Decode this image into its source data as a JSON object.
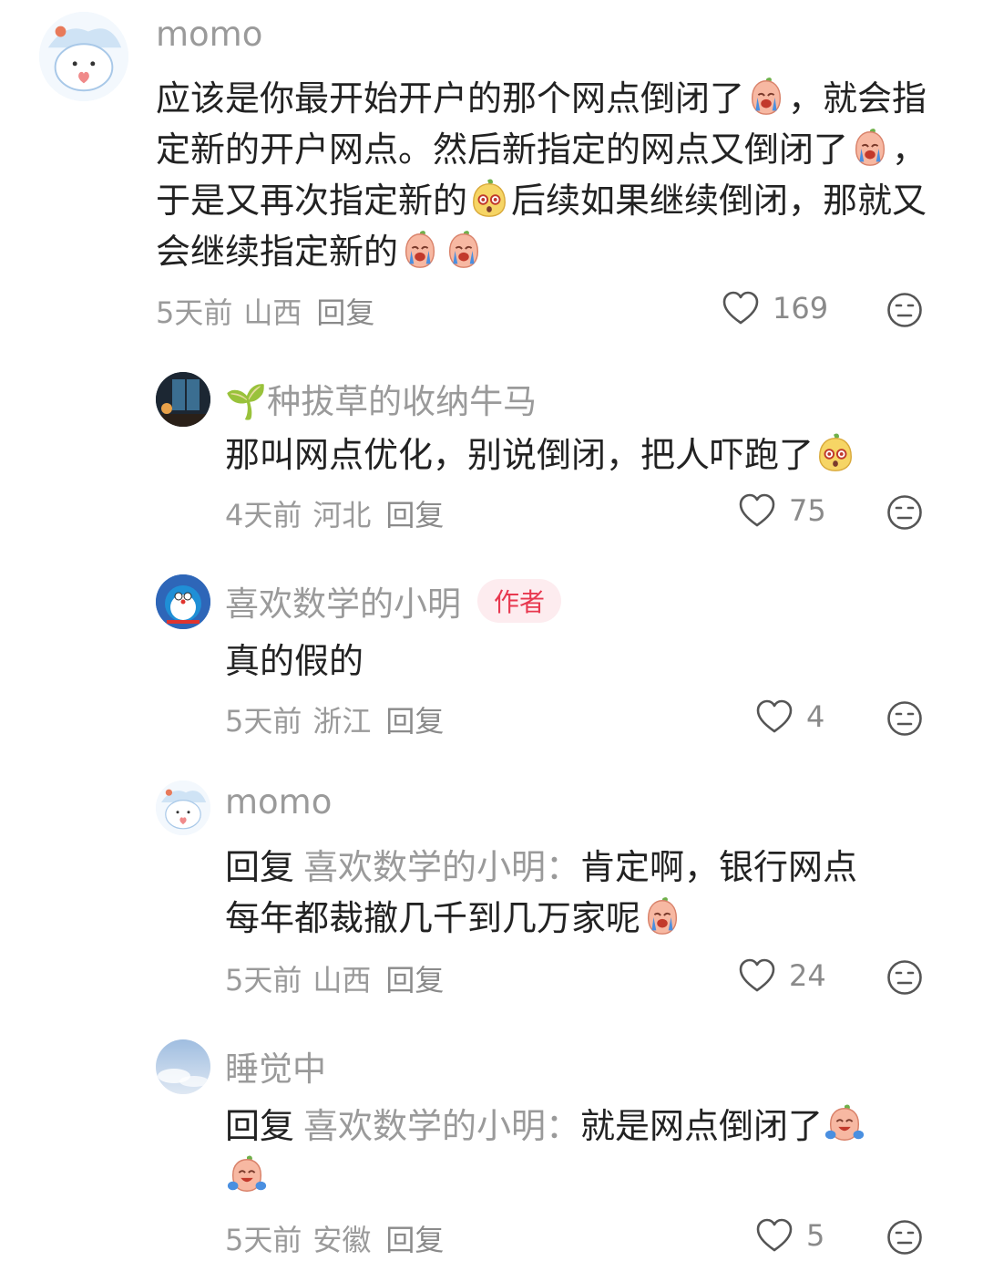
{
  "comments": [
    {
      "user": "momo",
      "text_parts": [
        "应该是你最开始开户的那个网点倒闭了",
        "，就会指定新的开户网点。然后新指定的网点又倒闭了",
        "，于是又再次指定新的",
        "后续如果继续倒闭，那就又会继续指定新的"
      ],
      "time": "5天前",
      "location": "山西",
      "reply_label": "回复",
      "likes": "169"
    },
    {
      "user": "🌱种拔草的收纳牛马",
      "text": "那叫网点优化，别说倒闭，把人吓跑了",
      "time": "4天前",
      "location": "河北",
      "reply_label": "回复",
      "likes": "75"
    },
    {
      "user": "喜欢数学的小明",
      "badge": "作者",
      "text": "真的假的",
      "time": "5天前",
      "location": "浙江",
      "reply_label": "回复",
      "likes": "4"
    },
    {
      "user": "momo",
      "reply_prefix": "回复",
      "reply_target": "喜欢数学的小明：",
      "text_line1": "肯定啊，银行网点",
      "text_line2": "每年都裁撤几千到几万家呢",
      "time": "5天前",
      "location": "山西",
      "reply_label": "回复",
      "likes": "24"
    },
    {
      "user": "睡觉中",
      "reply_prefix": "回复",
      "reply_target": "喜欢数学的小明：",
      "text": "就是网点倒闭了",
      "time": "5天前",
      "location": "安徽",
      "reply_label": "回复",
      "likes": "5"
    }
  ],
  "icons": {
    "like": "heart-outline-icon",
    "dislike": "meh-face-icon",
    "crying_emoji": "crying-peach-emoji",
    "shocked_emoji": "shocked-mango-emoji",
    "laugh_cry_emoji": "laugh-cry-peach-emoji"
  },
  "colors": {
    "secondary_text": "#9a9a9a",
    "badge_text": "#e8384f",
    "badge_bg": "#fdecef"
  }
}
